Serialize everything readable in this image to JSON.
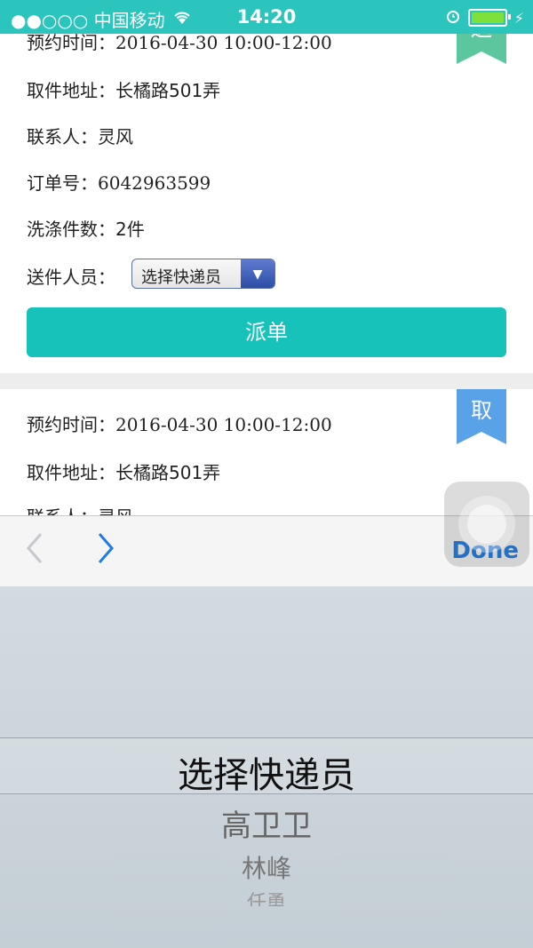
{
  "status_bar": {
    "carrier": "●●○○○ 中国移动",
    "time": "14:20"
  },
  "card1": {
    "pickup_time_label": "预约时间：",
    "pickup_time_value": "2016-04-30 10:00-12:00",
    "address_label": "取件地址：",
    "address_value": "长橘路501弄",
    "contact_label": "联系人：",
    "contact_value": "灵风",
    "order_label": "订单号：",
    "order_value": "6042963599",
    "count_label": "洗涤件数：",
    "count_value": "2件",
    "courier_label": "送件人员：",
    "courier_select_value": "选择快递员",
    "dispatch_button": "派单",
    "ribbon": "送"
  },
  "card2": {
    "pickup_time_label": "预约时间：",
    "pickup_time_value": "2016-04-30 10:00-12:00",
    "address_label": "取件地址：",
    "address_value": "长橘路501弄",
    "contact_label": "联系人：",
    "contact_value": "灵风",
    "ribbon": "取"
  },
  "toolbar": {
    "done": "Done"
  },
  "picker": {
    "selected": "选择快递员",
    "options": [
      "高卫卫",
      "林峰",
      "任勇"
    ]
  },
  "colors": {
    "accent": "#17c2bb",
    "status_bar": "#2cc5bd",
    "ribbon_blue": "#5aa2e8",
    "done_blue": "#1f7ce0"
  }
}
